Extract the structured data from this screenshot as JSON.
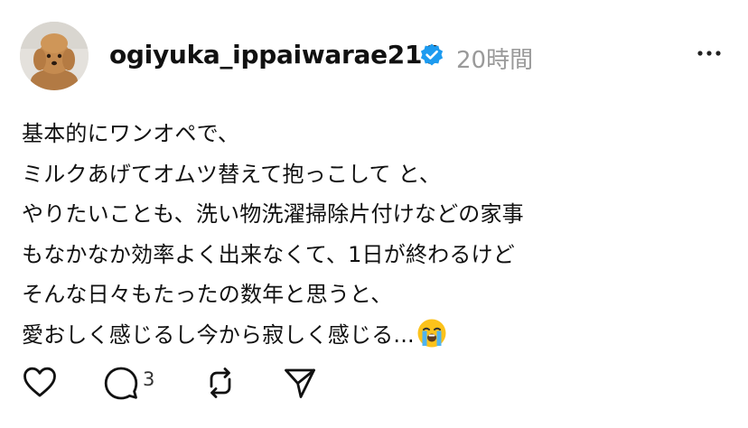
{
  "post": {
    "username": "ogiyuka_ippaiwarae216",
    "timestamp": "20時間",
    "lines": [
      "基本的にワンオペで、",
      "ミルクあげてオムツ替えて抱っこして と、",
      "やりたいことも、洗い物洗濯掃除片付けなどの家事",
      "もなかなか効率よく出来なくて、1日が終わるけど",
      "そんな日々もたったの数年と思うと、",
      "愛おしく感じるし今から寂しく感じる..."
    ],
    "trailing_emoji": "loudly-crying-face-emoji",
    "reply_count": "3"
  },
  "colors": {
    "verified_badge": "#1d9bf0",
    "timestamp": "#9a9a9a",
    "text": "#111111"
  },
  "icons": [
    "heart-icon",
    "comment-icon",
    "repost-icon",
    "share-icon",
    "more-icon",
    "verified-icon"
  ]
}
